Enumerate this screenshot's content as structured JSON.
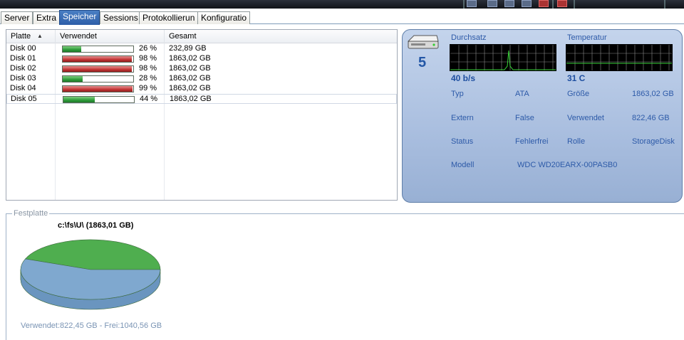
{
  "tabs": [
    {
      "label": "Server",
      "active": false
    },
    {
      "label": "Extra",
      "active": false
    },
    {
      "label": "Speicher",
      "active": true
    },
    {
      "label": "Sessions",
      "active": false
    },
    {
      "label": "Protokollierun",
      "active": false
    },
    {
      "label": "Konfiguratio",
      "active": false
    }
  ],
  "disks": {
    "columns": {
      "platte": "Platte",
      "verwendet": "Verwendet",
      "gesamt": "Gesamt"
    },
    "rows": [
      {
        "name": "Disk 00",
        "percent": 26,
        "percent_label": "26 %",
        "total": "232,89 GB",
        "level": "green"
      },
      {
        "name": "Disk 01",
        "percent": 98,
        "percent_label": "98 %",
        "total": "1863,02 GB",
        "level": "red"
      },
      {
        "name": "Disk 02",
        "percent": 98,
        "percent_label": "98 %",
        "total": "1863,02 GB",
        "level": "red"
      },
      {
        "name": "Disk 03",
        "percent": 28,
        "percent_label": "28 %",
        "total": "1863,02 GB",
        "level": "green"
      },
      {
        "name": "Disk 04",
        "percent": 99,
        "percent_label": "99 %",
        "total": "1863,02 GB",
        "level": "red"
      },
      {
        "name": "Disk 05",
        "percent": 44,
        "percent_label": "44 %",
        "total": "1863,02 GB",
        "level": "green",
        "selected": true
      }
    ]
  },
  "panel": {
    "disk_number": "5",
    "throughput_label": "Durchsatz",
    "throughput_value": "40 b/s",
    "temperature_label": "Temperatur",
    "temperature_value": "31 C",
    "typ_label": "Typ",
    "typ_value": "ATA",
    "groesse_label": "Größe",
    "groesse_value": "1863,02 GB",
    "extern_label": "Extern",
    "extern_value": "False",
    "verwendet_label": "Verwendet",
    "verwendet_value": "822,46 GB",
    "status_label": "Status",
    "status_value": "Fehlerfrei",
    "rolle_label": "Rolle",
    "rolle_value": "StorageDisk",
    "modell_label": "Modell",
    "modell_value": "WDC WD20EARX-00PASB0"
  },
  "festplatte": {
    "title": "Festplatte",
    "path": "c:\\fs\\U\\ (1863,01 GB)",
    "legend": "Verwendet:822,45 GB - Frei:1040,56 GB",
    "used_gb": 822.45,
    "free_gb": 1040.56
  },
  "colors": {
    "used_slice": "#4fae4f",
    "free_slice": "#7fa8cf",
    "accent": "#2d5aa8",
    "graph_line": "#39d339"
  }
}
